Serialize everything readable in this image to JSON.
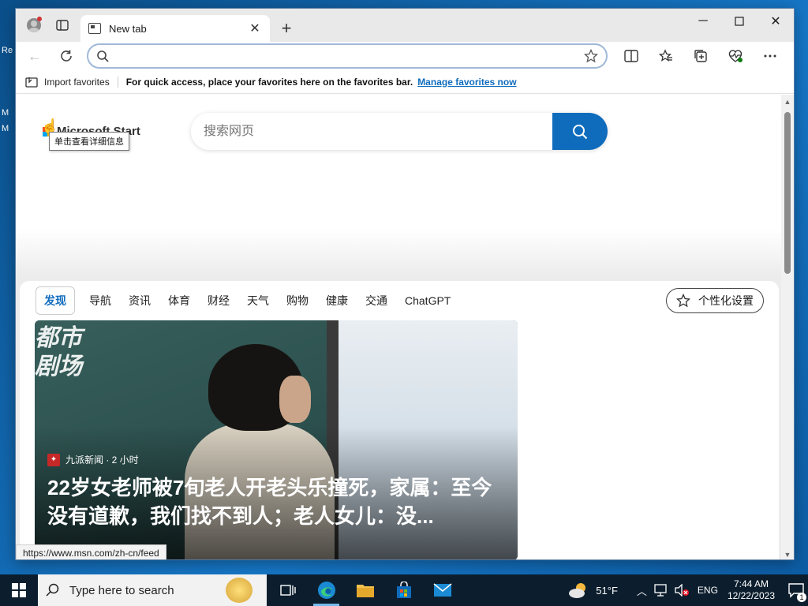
{
  "browser": {
    "tab_title": "New tab",
    "address_value": "",
    "favorites_bar": {
      "import_label": "Import favorites",
      "message": "For quick access, place your favorites here on the favorites bar.",
      "manage_link": "Manage favorites now"
    }
  },
  "page": {
    "logo_text": "Microsoft Start",
    "tooltip": "单击查看详细信息",
    "search_placeholder": "搜索网页",
    "feed_nav": [
      {
        "label": "发现",
        "active": true
      },
      {
        "label": "导航"
      },
      {
        "label": "资讯"
      },
      {
        "label": "体育"
      },
      {
        "label": "财经"
      },
      {
        "label": "天气"
      },
      {
        "label": "购物"
      },
      {
        "label": "健康"
      },
      {
        "label": "交通"
      },
      {
        "label": "ChatGPT"
      }
    ],
    "personalize_label": "个性化设置",
    "hero": {
      "image_text": "都市\n剧场",
      "source": "九派新闻 · 2 小时",
      "headline": "22岁女老师被7旬老人开老头乐撞死，家属：至今没有道歉，我们找不到人；老人女儿：没..."
    },
    "status_url": "https://www.msn.com/zh-cn/feed"
  },
  "taskbar": {
    "search_placeholder": "Type here to search",
    "weather": "51°F",
    "language": "ENG",
    "time": "7:44 AM",
    "date": "12/22/2023",
    "notification_count": "1"
  },
  "desktop": {
    "icon_labels": [
      "Re",
      "M",
      "M"
    ]
  }
}
